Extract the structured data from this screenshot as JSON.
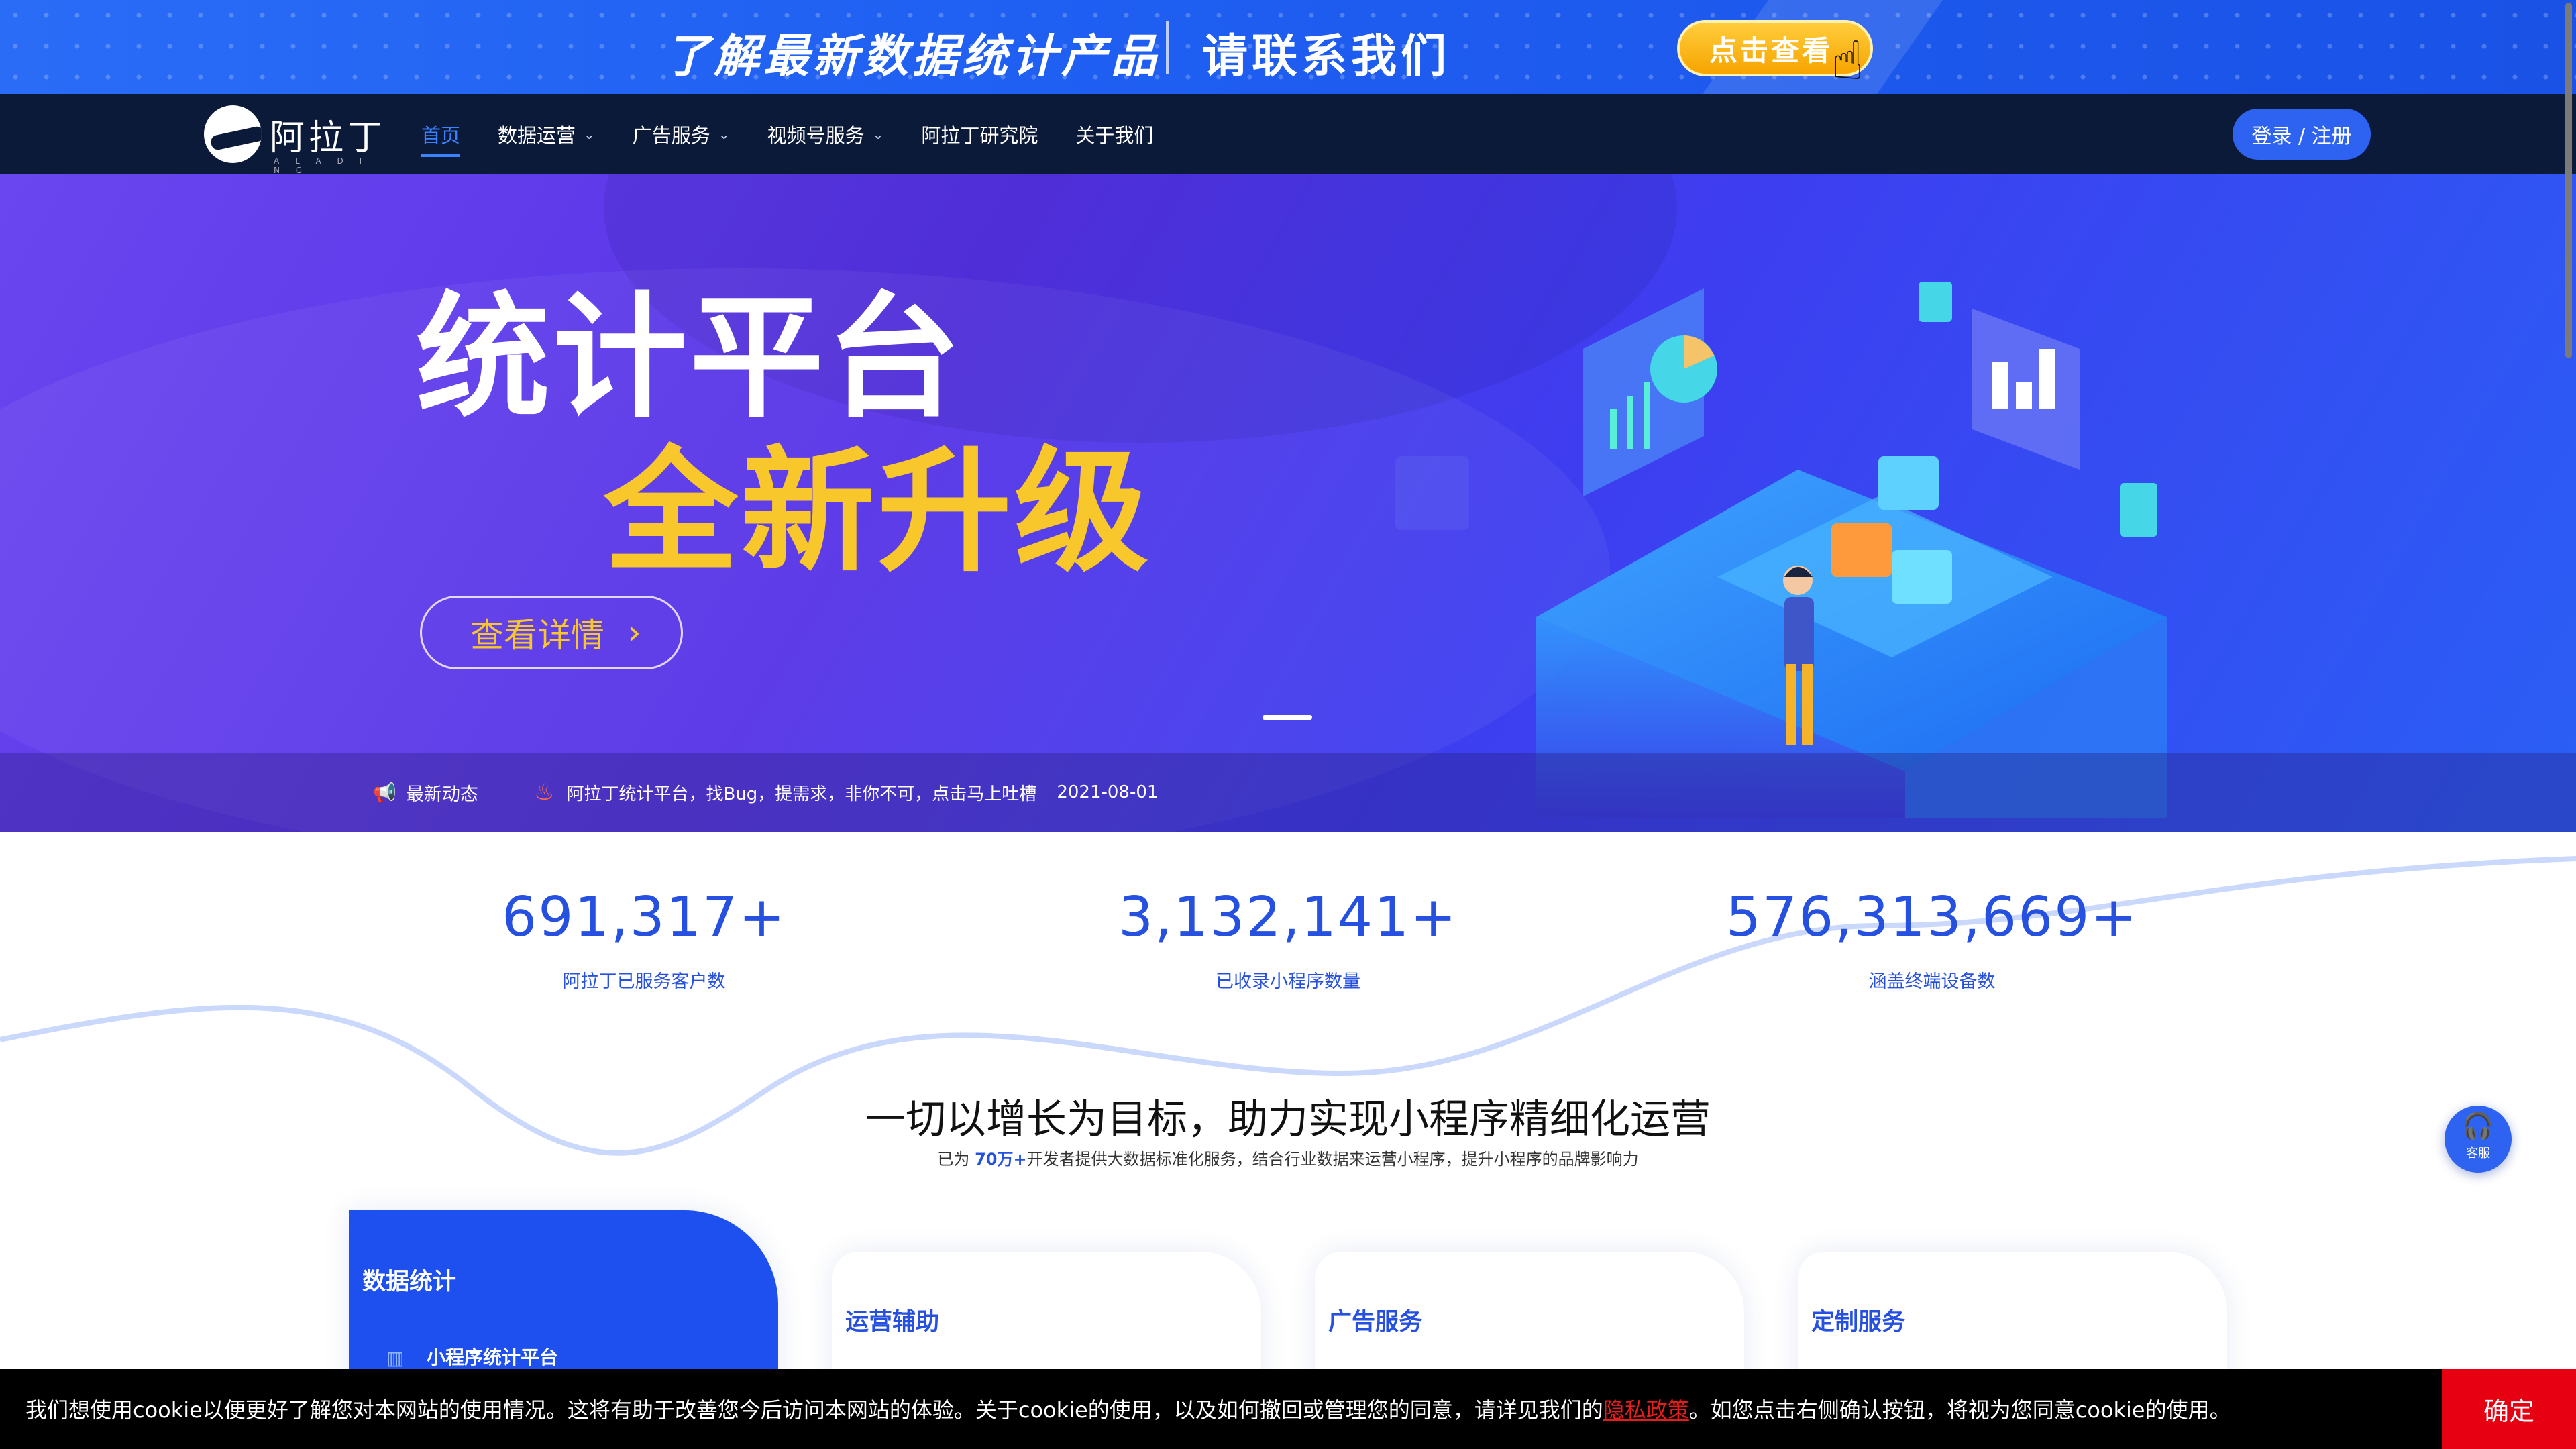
{
  "promo": {
    "title": "了解最新数据统计产品",
    "contact": "请联系我们",
    "button": "点击查看"
  },
  "nav": {
    "logo_text": "阿拉丁",
    "logo_sub": "A L A D I N G",
    "items": [
      {
        "label": "首页",
        "active": true,
        "dropdown": false
      },
      {
        "label": "数据运营",
        "active": false,
        "dropdown": true
      },
      {
        "label": "广告服务",
        "active": false,
        "dropdown": true
      },
      {
        "label": "视频号服务",
        "active": false,
        "dropdown": true
      },
      {
        "label": "阿拉丁研究院",
        "active": false,
        "dropdown": false
      },
      {
        "label": "关于我们",
        "active": false,
        "dropdown": false
      }
    ],
    "login": "登录 / 注册"
  },
  "hero": {
    "title_line1": "统计平台",
    "title_line2": "全新升级",
    "button": "查看详情",
    "news_label": "最新动态",
    "news_text": "阿拉丁统计平台，找Bug，提需求，非你不可，点击马上吐槽",
    "news_date": "2021-08-01"
  },
  "stats": [
    {
      "value": "691,317+",
      "label": "阿拉丁已服务客户数"
    },
    {
      "value": "3,132,141+",
      "label": "已收录小程序数量"
    },
    {
      "value": "576,313,669+",
      "label": "涵盖终端设备数"
    }
  ],
  "section": {
    "title": "一切以增长为目标，助力实现小程序精细化运营",
    "sub_prefix": "已为 ",
    "sub_highlight": "70万+",
    "sub_suffix": "开发者提供大数据标准化服务，结合行业数据来运营小程序，提升小程序的品牌影响力"
  },
  "cards": [
    {
      "title": "数据统计",
      "item": "小程序统计平台"
    },
    {
      "title": "运营辅助"
    },
    {
      "title": "广告服务"
    },
    {
      "title": "定制服务"
    }
  ],
  "float_service": {
    "label": "客服"
  },
  "cookie": {
    "text_before": "我们想使用cookie以便更好了解您对本网站的使用情况。这将有助于改善您今后访问本网站的体验。关于cookie的使用，以及如何撤回或管理您的同意，请详见我们的",
    "link": "隐私政策",
    "text_after": "。如您点击右侧确认按钮，将视为您同意cookie的使用。",
    "button": "确定"
  },
  "colors": {
    "brand_blue": "#2650e0",
    "nav_bg": "#0c1a3a",
    "accent_yellow": "#f7c72c",
    "cookie_button": "#e60012"
  }
}
